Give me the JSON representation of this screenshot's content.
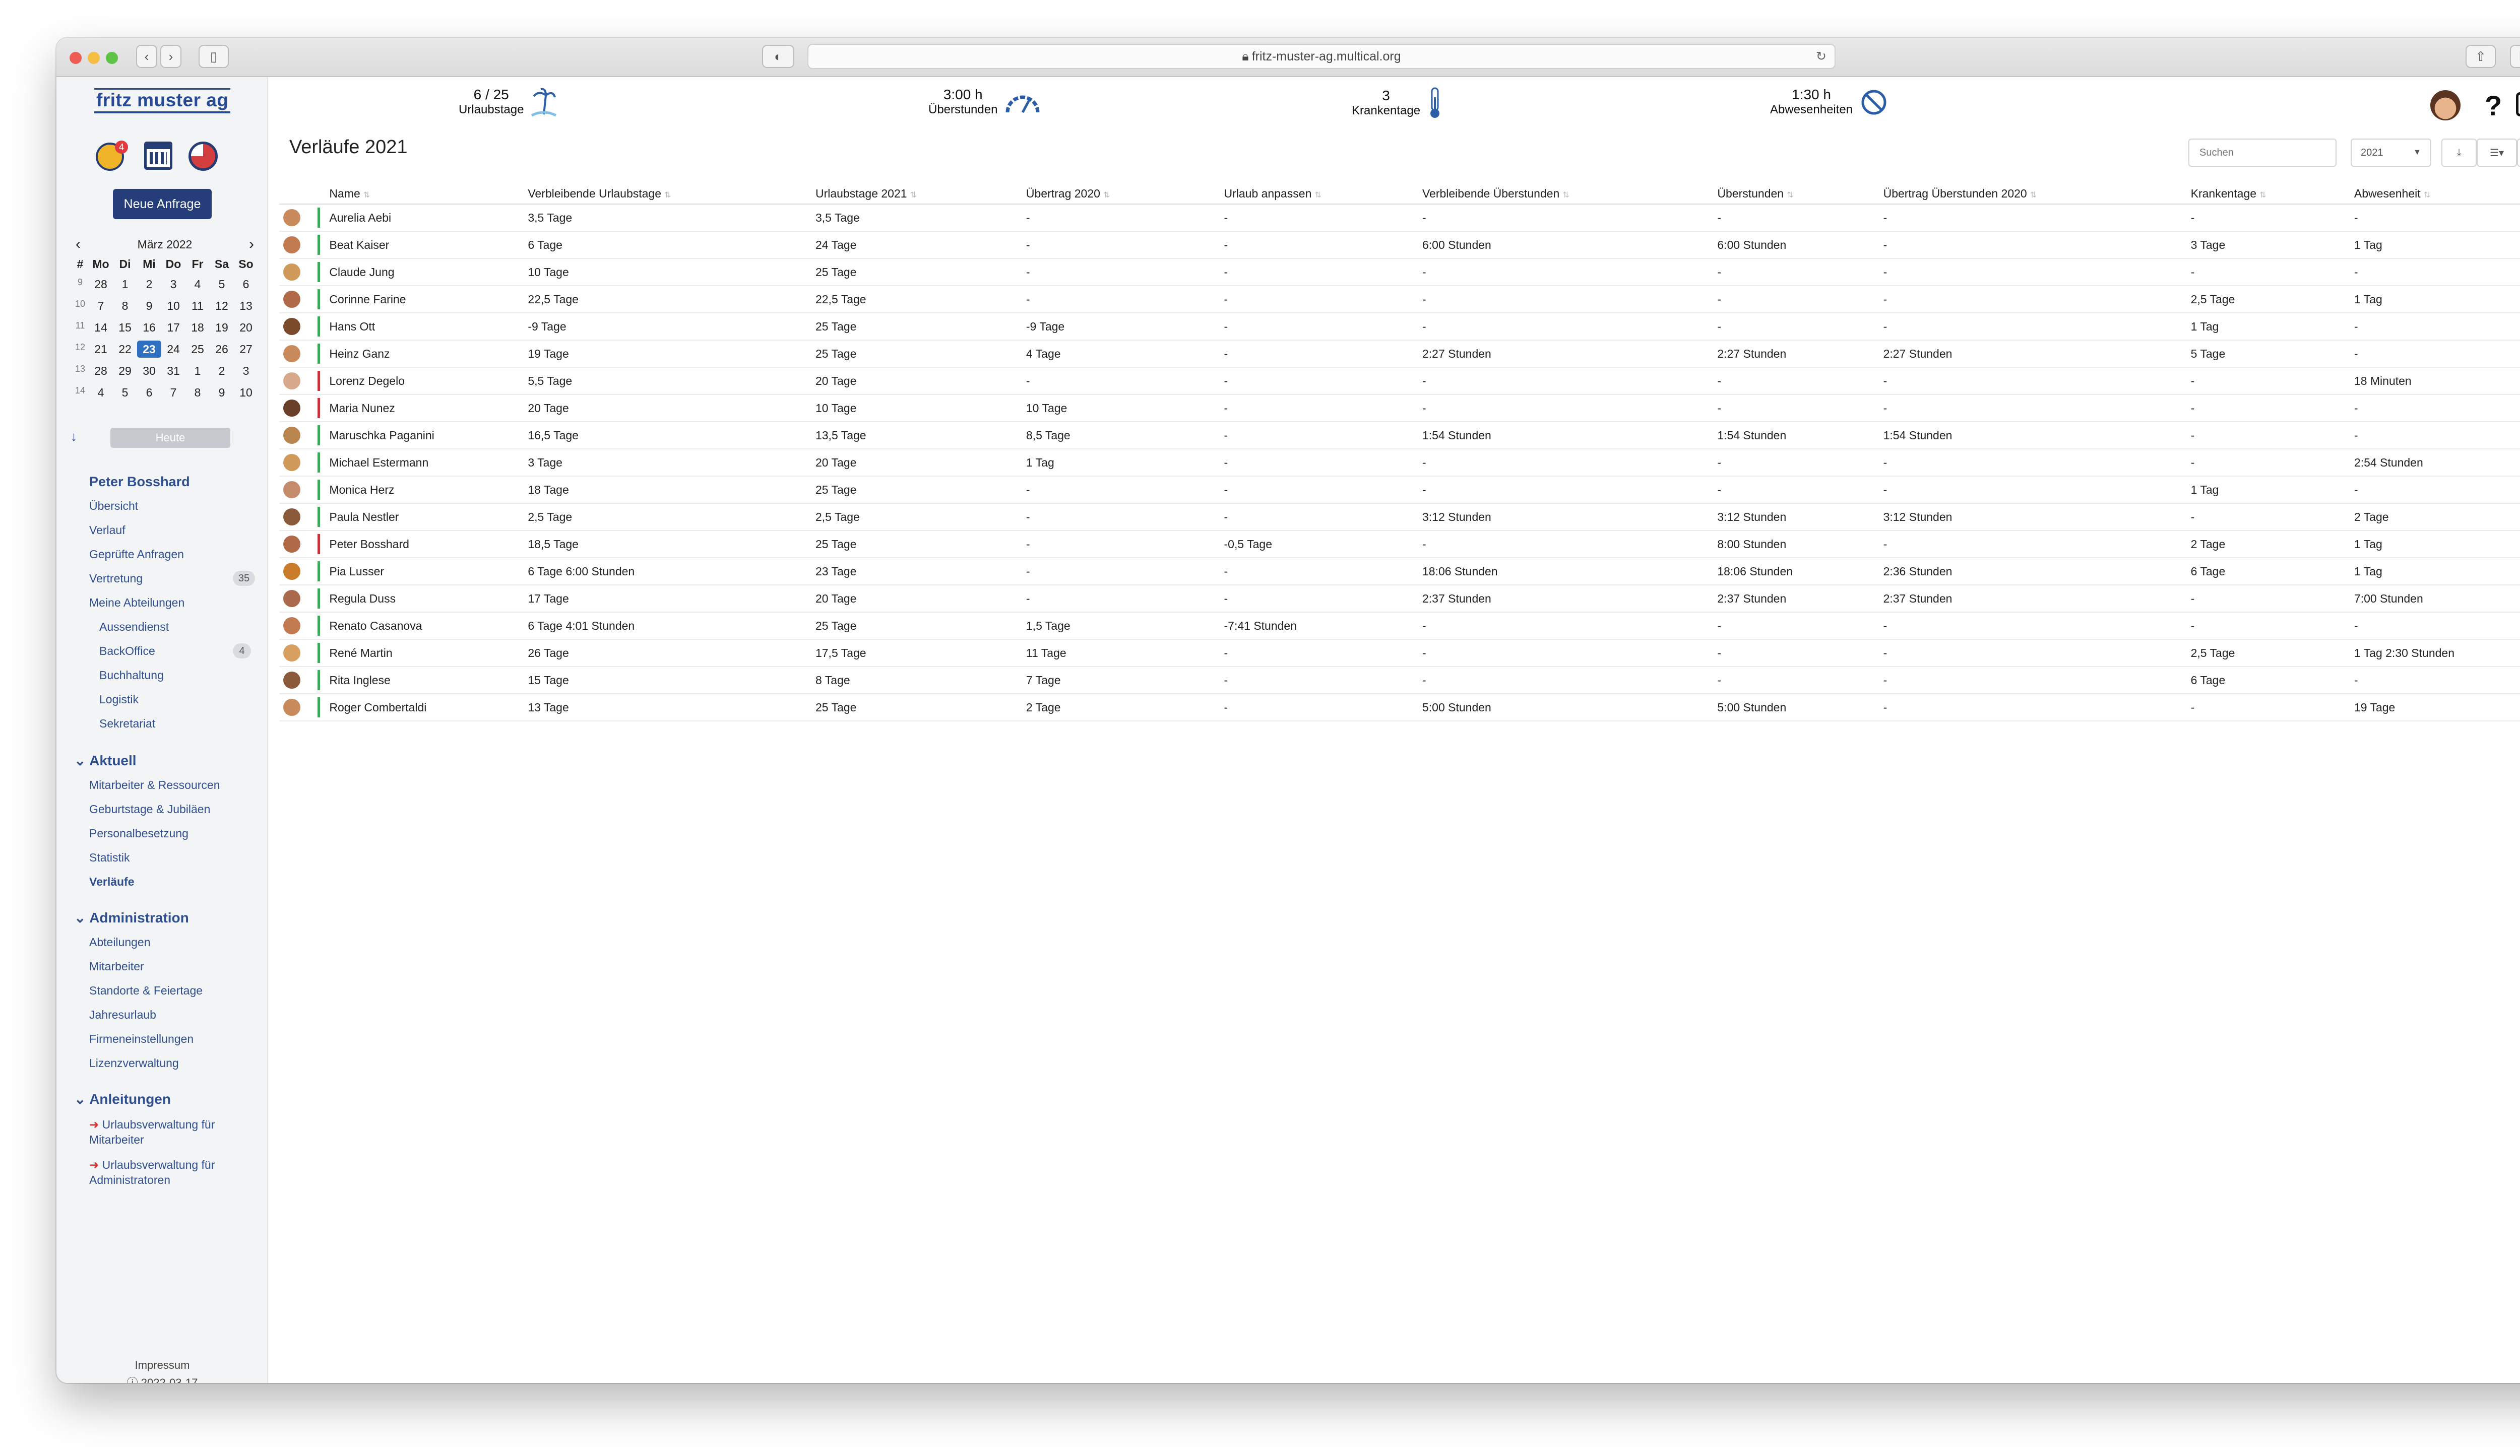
{
  "browser": {
    "url": "fritz-muster-ag.multical.org"
  },
  "app": {
    "logo": "fritz muster ag",
    "notif_count": "4",
    "new_request": "Neue Anfrage",
    "today": "Heute"
  },
  "calendar": {
    "title": "März 2022",
    "headers": [
      "#",
      "Mo",
      "Di",
      "Mi",
      "Do",
      "Fr",
      "Sa",
      "So"
    ],
    "weeks": [
      [
        "9",
        "28",
        "1",
        "2",
        "3",
        "4",
        "5",
        "6"
      ],
      [
        "10",
        "7",
        "8",
        "9",
        "10",
        "11",
        "12",
        "13"
      ],
      [
        "11",
        "14",
        "15",
        "16",
        "17",
        "18",
        "19",
        "20"
      ],
      [
        "12",
        "21",
        "22",
        "23",
        "24",
        "25",
        "26",
        "27"
      ],
      [
        "13",
        "28",
        "29",
        "30",
        "31",
        "1",
        "2",
        "3"
      ],
      [
        "14",
        "4",
        "5",
        "6",
        "7",
        "8",
        "9",
        "10"
      ]
    ]
  },
  "nav": {
    "user": "Peter Bosshard",
    "uebersicht": "Übersicht",
    "verlauf": "Verlauf",
    "gepruefte": "Geprüfte Anfragen",
    "vertretung": "Vertretung",
    "vertretung_count": "35",
    "abteilungen": "Meine Abteilungen",
    "aussendienst": "Aussendienst",
    "backoffice": "BackOffice",
    "backoffice_count": "4",
    "buchhaltung": "Buchhaltung",
    "logistik": "Logistik",
    "sekretariat": "Sekretariat",
    "aktuell": "Aktuell",
    "mitarbeiter_ress": "Mitarbeiter & Ressourcen",
    "geburtstage": "Geburtstage & Jubiläen",
    "personal": "Personalbesetzung",
    "statistik": "Statistik",
    "verlaeufe": "Verläufe",
    "administration": "Administration",
    "abteilungen2": "Abteilungen",
    "mitarbeiter": "Mitarbeiter",
    "standorte": "Standorte & Feiertage",
    "jahresurlaub": "Jahresurlaub",
    "firmen": "Firmeneinstellungen",
    "lizenz": "Lizenzverwaltung",
    "anleitungen": "Anleitungen",
    "anl1a": "Urlaubsverwaltung für",
    "anl1b": "Mitarbeiter",
    "anl2a": "Urlaubsverwaltung für",
    "anl2b": "Administratoren"
  },
  "footer": {
    "date": "2022-03-17",
    "impressum": "Impressum"
  },
  "stats": {
    "urlaub_value": "6 / 25",
    "urlaub_label": "Urlaubstage",
    "ueber_value": "3:00 h",
    "ueber_label": "Überstunden",
    "krank_value": "3",
    "krank_label": "Krankentage",
    "abw_value": "1:30 h",
    "abw_label": "Abwesenheiten"
  },
  "page": {
    "title": "Verläufe 2021",
    "search_placeholder": "Suchen",
    "year": "2021"
  },
  "table": {
    "headers": [
      "Name",
      "Verbleibende Urlaubstage",
      "Urlaubstage 2021",
      "Übertrag 2020",
      "Urlaub anpassen",
      "Verbleibende Überstunden",
      "Überstunden",
      "Übertrag Überstunden 2020",
      "Krankentage",
      "Abwesenheit"
    ],
    "rows": [
      [
        "Aurelia Aebi",
        "3,5 Tage",
        "3,5 Tage",
        "-",
        "-",
        "-",
        "-",
        "-",
        "-",
        "-"
      ],
      [
        "Beat Kaiser",
        "6 Tage",
        "24 Tage",
        "-",
        "-",
        "6:00 Stunden",
        "6:00 Stunden",
        "-",
        "3 Tage",
        "1 Tag"
      ],
      [
        "Claude Jung",
        "10 Tage",
        "25 Tage",
        "-",
        "-",
        "-",
        "-",
        "-",
        "-",
        "-"
      ],
      [
        "Corinne Farine",
        "22,5 Tage",
        "22,5 Tage",
        "-",
        "-",
        "-",
        "-",
        "-",
        "2,5 Tage",
        "1 Tag"
      ],
      [
        "Hans Ott",
        "-9 Tage",
        "25 Tage",
        "-9 Tage",
        "-",
        "-",
        "-",
        "-",
        "1 Tag",
        "-"
      ],
      [
        "Heinz Ganz",
        "19 Tage",
        "25 Tage",
        "4 Tage",
        "-",
        "2:27 Stunden",
        "2:27 Stunden",
        "2:27 Stunden",
        "5 Tage",
        "-"
      ],
      [
        "Lorenz Degelo",
        "5,5 Tage",
        "20 Tage",
        "-",
        "-",
        "-",
        "-",
        "-",
        "-",
        "18 Minuten"
      ],
      [
        "Maria Nunez",
        "20 Tage",
        "10 Tage",
        "10 Tage",
        "-",
        "-",
        "-",
        "-",
        "-",
        "-"
      ],
      [
        "Maruschka Paganini",
        "16,5 Tage",
        "13,5 Tage",
        "8,5 Tage",
        "-",
        "1:54 Stunden",
        "1:54 Stunden",
        "1:54 Stunden",
        "-",
        "-"
      ],
      [
        "Michael Estermann",
        "3 Tage",
        "20 Tage",
        "1 Tag",
        "-",
        "-",
        "-",
        "-",
        "-",
        "2:54 Stunden"
      ],
      [
        "Monica Herz",
        "18 Tage",
        "25 Tage",
        "-",
        "-",
        "-",
        "-",
        "-",
        "1 Tag",
        "-"
      ],
      [
        "Paula Nestler",
        "2,5 Tage",
        "2,5 Tage",
        "-",
        "-",
        "3:12 Stunden",
        "3:12 Stunden",
        "3:12 Stunden",
        "-",
        "2 Tage"
      ],
      [
        "Peter Bosshard",
        "18,5 Tage",
        "25 Tage",
        "-",
        "-0,5 Tage",
        "-",
        "8:00 Stunden",
        "-",
        "2 Tage",
        "1 Tag"
      ],
      [
        "Pia Lusser",
        "6 Tage 6:00 Stunden",
        "23 Tage",
        "-",
        "-",
        "18:06 Stunden",
        "18:06 Stunden",
        "2:36 Stunden",
        "6 Tage",
        "1 Tag"
      ],
      [
        "Regula Duss",
        "17 Tage",
        "20 Tage",
        "-",
        "-",
        "2:37 Stunden",
        "2:37 Stunden",
        "2:37 Stunden",
        "-",
        "7:00 Stunden"
      ],
      [
        "Renato Casanova",
        "6 Tage 4:01 Stunden",
        "25 Tage",
        "1,5 Tage",
        "-7:41 Stunden",
        "-",
        "-",
        "-",
        "-",
        "-"
      ],
      [
        "René Martin",
        "26 Tage",
        "17,5 Tage",
        "11 Tage",
        "-",
        "-",
        "-",
        "-",
        "2,5 Tage",
        "1 Tag 2:30 Stunden"
      ],
      [
        "Rita Inglese",
        "15 Tage",
        "8 Tage",
        "7 Tage",
        "-",
        "-",
        "-",
        "-",
        "6 Tage",
        "-"
      ],
      [
        "Roger Combertaldi",
        "13 Tage",
        "25 Tage",
        "2 Tage",
        "-",
        "5:00 Stunden",
        "5:00 Stunden",
        "-",
        "-",
        "19 Tage"
      ]
    ],
    "bar_colors": [
      "#3ea85a",
      "#3ea85a",
      "#3ea85a",
      "#3ea85a",
      "#3ea85a",
      "#3ea85a",
      "#c7313d",
      "#c7313d",
      "#3ea85a",
      "#3ea85a",
      "#3ea85a",
      "#3ea85a",
      "#c7313d",
      "#3ea85a",
      "#3ea85a",
      "#3ea85a",
      "#3ea85a",
      "#3ea85a",
      "#3ea85a"
    ],
    "avatar_colors": [
      "#c98a5c",
      "#c27a50",
      "#d09a5a",
      "#b06a48",
      "#7a4a2a",
      "#c98a5c",
      "#d8a88a",
      "#6a3f2a",
      "#b8864e",
      "#d09a5a",
      "#c48c6a",
      "#8a5a3a",
      "#b06a48",
      "#c97c2a",
      "#a86a4a",
      "#c27a50",
      "#d8a060",
      "#8a5a3a",
      "#c98a5c"
    ]
  }
}
